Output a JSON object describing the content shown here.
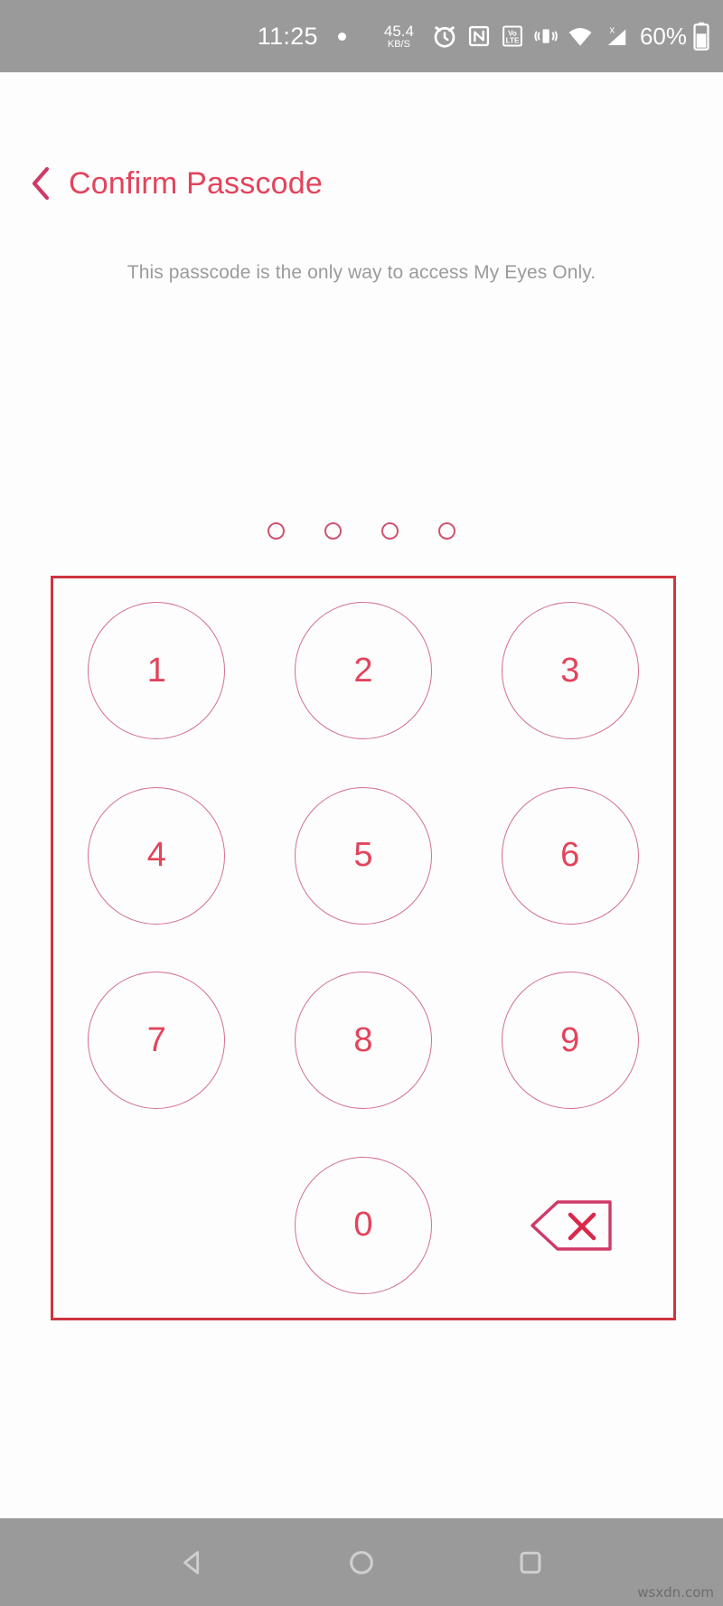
{
  "status_bar": {
    "time": "11:25",
    "recording_dot": "dot-indicator",
    "net_speed_value": "45.4",
    "net_speed_unit": "KB/S",
    "icons": [
      "alarm-clock-icon",
      "nfc-icon",
      "volte-icon",
      "vibrate-icon",
      "wifi-icon",
      "cellular-signal-icon"
    ],
    "battery_percent": "60%",
    "battery_icon": "battery-icon",
    "background_color": "#9a9a9a"
  },
  "header": {
    "back_icon": "chevron-left-icon",
    "title": "Confirm Passcode",
    "accent_color": "#e2445c"
  },
  "subtitle": {
    "text": "This passcode is the only way to access My Eyes Only.",
    "color": "#9b9b9b"
  },
  "passcode": {
    "length": 4,
    "entered": 0,
    "dots": [
      {
        "name": "passcode-dot-1",
        "filled": false
      },
      {
        "name": "passcode-dot-2",
        "filled": false
      },
      {
        "name": "passcode-dot-3",
        "filled": false
      },
      {
        "name": "passcode-dot-4",
        "filled": false
      }
    ],
    "dot_color": "#cf5271"
  },
  "keypad": {
    "border_color": "#cf3440",
    "key_border_color": "#d2708c",
    "digit_color": "#e2445c",
    "keys": [
      {
        "label": "1",
        "name": "keypad-key-1",
        "type": "digit"
      },
      {
        "label": "2",
        "name": "keypad-key-2",
        "type": "digit"
      },
      {
        "label": "3",
        "name": "keypad-key-3",
        "type": "digit"
      },
      {
        "label": "4",
        "name": "keypad-key-4",
        "type": "digit"
      },
      {
        "label": "5",
        "name": "keypad-key-5",
        "type": "digit"
      },
      {
        "label": "6",
        "name": "keypad-key-6",
        "type": "digit"
      },
      {
        "label": "7",
        "name": "keypad-key-7",
        "type": "digit"
      },
      {
        "label": "8",
        "name": "keypad-key-8",
        "type": "digit"
      },
      {
        "label": "9",
        "name": "keypad-key-9",
        "type": "digit"
      },
      {
        "label": "",
        "name": "keypad-key-blank",
        "type": "blank"
      },
      {
        "label": "0",
        "name": "keypad-key-0",
        "type": "digit"
      },
      {
        "label": "",
        "name": "keypad-key-backspace",
        "type": "backspace"
      }
    ]
  },
  "nav_bar": {
    "back": "nav-back-icon",
    "home": "nav-home-icon",
    "recents": "nav-recents-icon",
    "background_color": "#9a9a9a"
  },
  "watermark": {
    "text": "wsxdn.com"
  }
}
